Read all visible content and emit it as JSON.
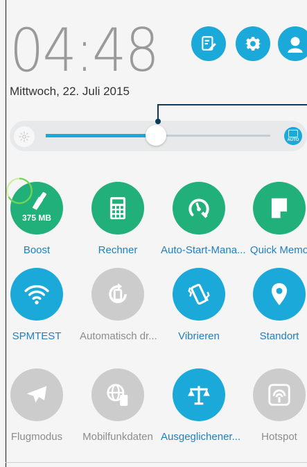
{
  "clock": {
    "time": "04:48"
  },
  "date": "Mittwoch, 22. Juli 2015",
  "header_icons": [
    "edit-icon",
    "settings-icon",
    "user-avatar-icon"
  ],
  "brightness": {
    "level": 0.49,
    "auto_label": "AUTO"
  },
  "colors": {
    "accent_blue": "#1aa9d8",
    "green": "#21b07a",
    "grey": "#cccccc"
  },
  "tiles": [
    {
      "label": "Boost",
      "badge": "375 MB",
      "icon": "brush-icon",
      "style": "green"
    },
    {
      "label": "Rechner",
      "icon": "calculator-icon",
      "style": "green"
    },
    {
      "label": "Auto-Start-Mana...",
      "icon": "gauge-wrench-icon",
      "style": "green"
    },
    {
      "label": "Quick Memo",
      "icon": "memo-icon",
      "style": "green"
    },
    {
      "label": "SPMTEST",
      "icon": "wifi-icon",
      "style": "blue"
    },
    {
      "label": "Automatisch dr...",
      "icon": "rotate-icon",
      "style": "grey"
    },
    {
      "label": "Vibrieren",
      "icon": "vibrate-icon",
      "style": "blue"
    },
    {
      "label": "Standort",
      "icon": "location-icon",
      "style": "blue"
    },
    {
      "label": "Flugmodus",
      "icon": "airplane-icon",
      "style": "grey"
    },
    {
      "label": "Mobilfunkdaten",
      "icon": "mobile-data-icon",
      "style": "grey"
    },
    {
      "label": "Ausgeglichener...",
      "icon": "balance-icon",
      "style": "blue"
    },
    {
      "label": "Hotspot",
      "icon": "hotspot-icon",
      "style": "grey"
    }
  ]
}
